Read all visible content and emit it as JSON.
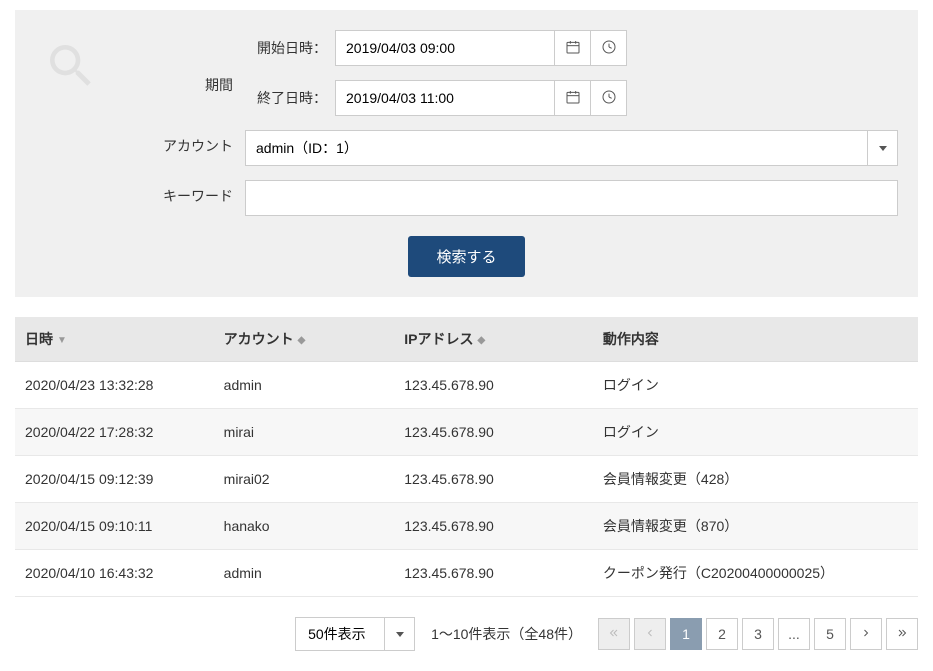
{
  "search": {
    "period_label": "期間",
    "start_label": "開始日時：",
    "start_value": "2019/04/03 09:00",
    "end_label": "終了日時：",
    "end_value": "2019/04/03 11:00",
    "account_label": "アカウント",
    "account_value": "admin（ID：1）",
    "keyword_label": "キーワード",
    "keyword_value": "",
    "submit_label": "検索する"
  },
  "table": {
    "headers": {
      "datetime": "日時",
      "account": "アカウント",
      "ip": "IPアドレス",
      "action": "動作内容"
    },
    "rows": [
      {
        "datetime": "2020/04/23 13:32:28",
        "account": "admin",
        "ip": "123.45.678.90",
        "action": "ログイン"
      },
      {
        "datetime": "2020/04/22 17:28:32",
        "account": "mirai",
        "ip": "123.45.678.90",
        "action": "ログイン"
      },
      {
        "datetime": "2020/04/15 09:12:39",
        "account": "mirai02",
        "ip": "123.45.678.90",
        "action": "会員情報変更（428）"
      },
      {
        "datetime": "2020/04/15 09:10:11",
        "account": "hanako",
        "ip": "123.45.678.90",
        "action": "会員情報変更（870）"
      },
      {
        "datetime": "2020/04/10 16:43:32",
        "account": "admin",
        "ip": "123.45.678.90",
        "action": "クーポン発行（C20200400000025）"
      }
    ]
  },
  "footer": {
    "page_size": "50件表示",
    "page_info": "1～10件表示（全48件）",
    "pages": [
      "1",
      "2",
      "3",
      "...",
      "5"
    ],
    "active_page": "1"
  }
}
